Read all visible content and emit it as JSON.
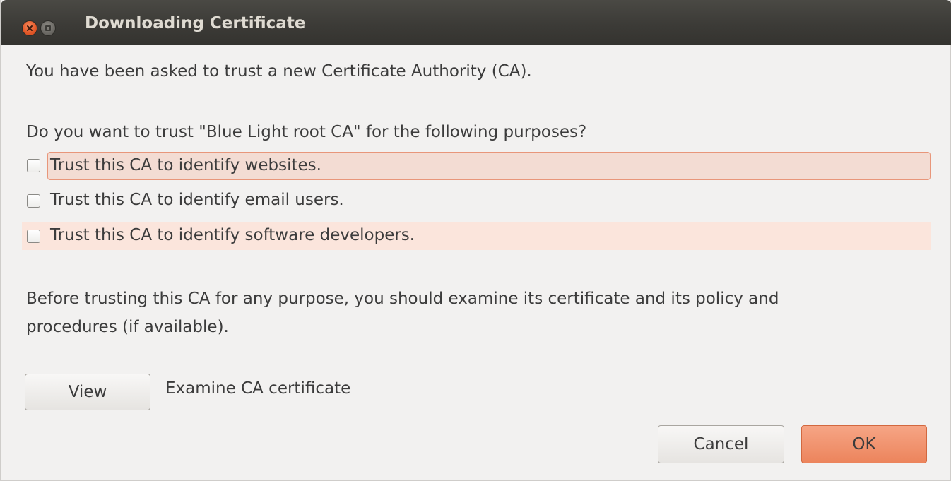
{
  "window": {
    "title": "Downloading Certificate"
  },
  "dialog": {
    "intro": "You have been asked to trust a new Certificate Authority (CA).",
    "question": "Do you want to trust \"Blue Light root CA\" for the following purposes?",
    "options": [
      {
        "label": "Trust this CA to identify websites.",
        "checked": false
      },
      {
        "label": "Trust this CA to identify email users.",
        "checked": false
      },
      {
        "label": "Trust this CA to identify software developers.",
        "checked": false
      }
    ],
    "advice_line1": "Before trusting this CA for any purpose, you should examine its certificate and its policy and",
    "advice_line2": "procedures (if available).",
    "view_button": "View",
    "view_description": "Examine CA certificate",
    "cancel_button": "Cancel",
    "ok_button": "OK"
  },
  "colors": {
    "titlebar": "#3c3b37",
    "accent": "#ec845c",
    "background": "#f2f1f0"
  }
}
